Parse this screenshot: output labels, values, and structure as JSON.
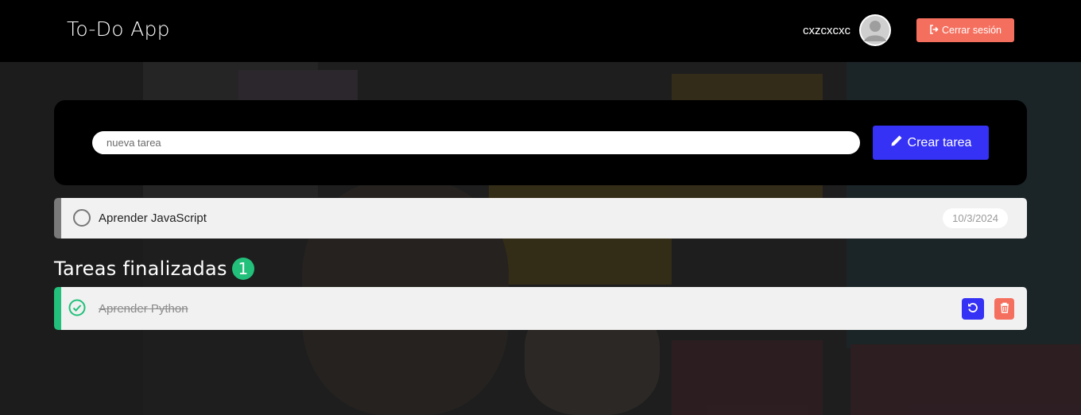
{
  "navbar": {
    "brand": "To-Do App",
    "username": "cxzcxcxc",
    "logout_label": "Cerrar sesión",
    "logout_color": "#f56f5e"
  },
  "create": {
    "placeholder": "nueva tarea",
    "button_label": "Crear tarea",
    "button_color": "#3531f5"
  },
  "pending_tasks": [
    {
      "text": "Aprender JavaScript",
      "date": "10/3/2024",
      "done": false
    }
  ],
  "finished": {
    "title": "Tareas finalizadas",
    "count": "1",
    "accent_color": "#22c07a",
    "tasks": [
      {
        "text": "Aprender Python",
        "done": true,
        "restore_icon": "undo-icon",
        "delete_icon": "trash-icon"
      }
    ]
  }
}
